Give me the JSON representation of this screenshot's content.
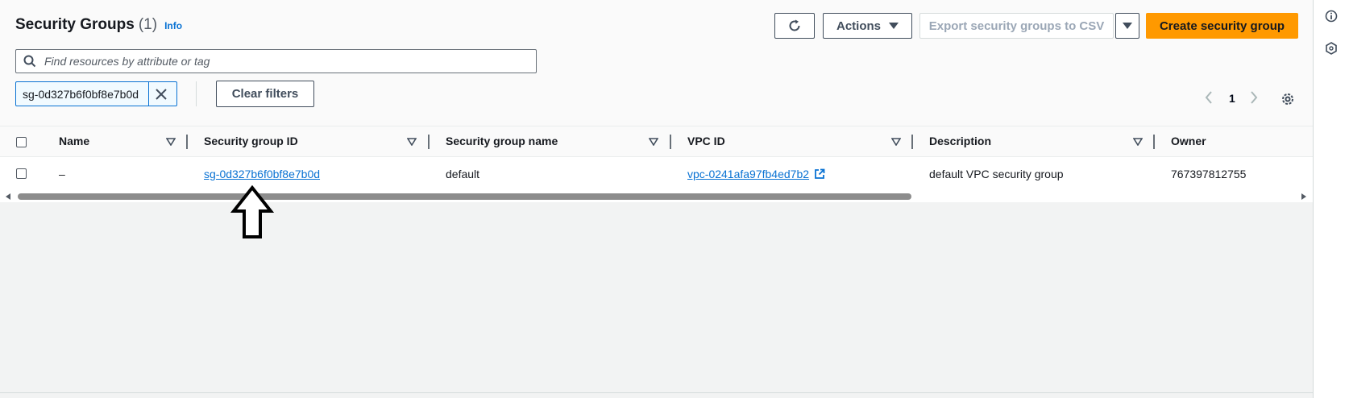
{
  "header": {
    "title": "Security Groups",
    "count": "(1)",
    "info": "Info"
  },
  "toolbar": {
    "actions_label": "Actions",
    "export_label": "Export security groups to CSV",
    "create_label": "Create security group"
  },
  "search": {
    "placeholder": "Find resources by attribute or tag"
  },
  "filters": {
    "token": "sg-0d327b6f0bf8e7b0d",
    "clear_label": "Clear filters"
  },
  "pagination": {
    "current_page": "1"
  },
  "table": {
    "columns": [
      "Name",
      "Security group ID",
      "Security group name",
      "VPC ID",
      "Description",
      "Owner"
    ],
    "rows": [
      {
        "name": "–",
        "security_group_id": "sg-0d327b6f0bf8e7b0d",
        "security_group_name": "default",
        "vpc_id": "vpc-0241afa97fb4ed7b2",
        "description": "default VPC security group",
        "owner": "767397812755"
      }
    ]
  },
  "icons": {
    "refresh": "refresh-icon",
    "search": "search-icon",
    "close": "close-icon",
    "settings": "gear-icon",
    "external": "external-link-icon",
    "info": "info-circle-icon",
    "help": "hexagon-icon"
  },
  "colors": {
    "primary": "#ff9900",
    "link": "#0972d3",
    "text": "#16191f"
  }
}
